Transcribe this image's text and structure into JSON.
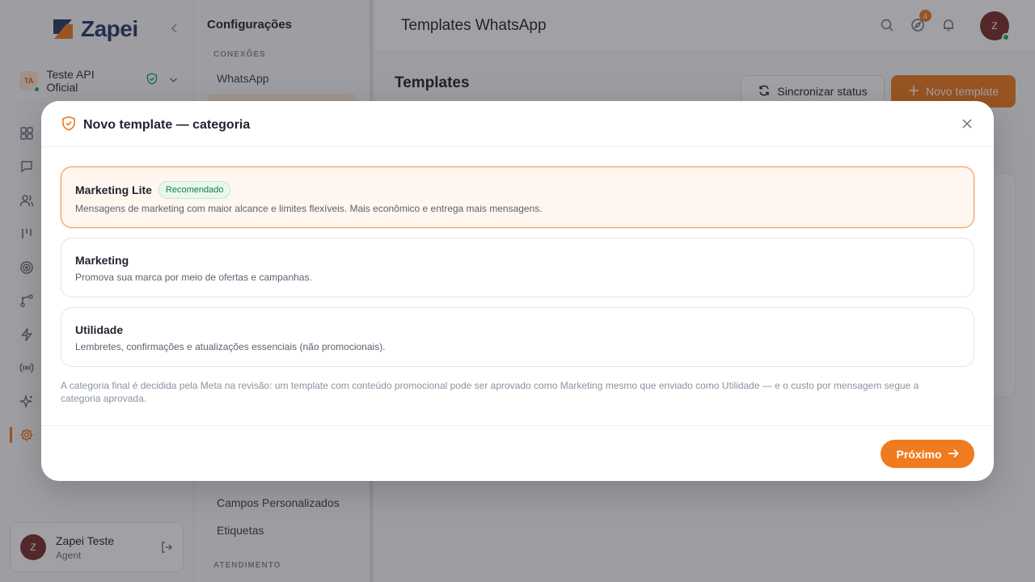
{
  "brand": {
    "name": "Zapei",
    "logo_icon": "zapei-logo-icon"
  },
  "account": {
    "initials": "TA",
    "name": "Teste API Oficial"
  },
  "nav_icons": [
    "dashboard-icon",
    "chat-icon",
    "contacts-icon",
    "kanban-icon",
    "target-icon",
    "flow-icon",
    "bolt-icon",
    "broadcast-icon",
    "sparkles-icon",
    "settings-icon"
  ],
  "user": {
    "initials": "Z",
    "name": "Zapei Teste",
    "role": "Agent"
  },
  "settings": {
    "title": "Configurações",
    "section_conexoes": "CONEXÕES",
    "item_whatsapp": "WhatsApp",
    "item_campos": "Campos Personalizados",
    "item_etiquetas": "Etiquetas",
    "section_atendimento": "ATENDIMENTO"
  },
  "topbar": {
    "title": "Templates WhatsApp",
    "notification_count": "4",
    "avatar_initials": "Z"
  },
  "main": {
    "heading": "Templates",
    "sync_button": "Sincronizar status",
    "new_button": "Novo template"
  },
  "modal": {
    "title": "Novo template — categoria",
    "options": [
      {
        "title": "Marketing Lite",
        "badge": "Recomendado",
        "description": "Mensagens de marketing com maior alcance e limites flexíveis. Mais econômico e entrega mais mensagens.",
        "selected": true
      },
      {
        "title": "Marketing",
        "description": "Promova sua marca por meio de ofertas e campanhas.",
        "selected": false
      },
      {
        "title": "Utilidade",
        "description": "Lembretes, confirmações e atualizações essenciais (não promocionais).",
        "selected": false
      }
    ],
    "note": "A categoria final é decidida pela Meta na revisão: um template com conteúdo promocional pode ser aprovado como Marketing mesmo que enviado como Utilidade — e o custo por mensagem segue a categoria aprovada.",
    "next_button": "Próximo"
  },
  "colors": {
    "accent": "#f07b1e",
    "success": "#22a55b",
    "navy": "#2b3a67"
  }
}
